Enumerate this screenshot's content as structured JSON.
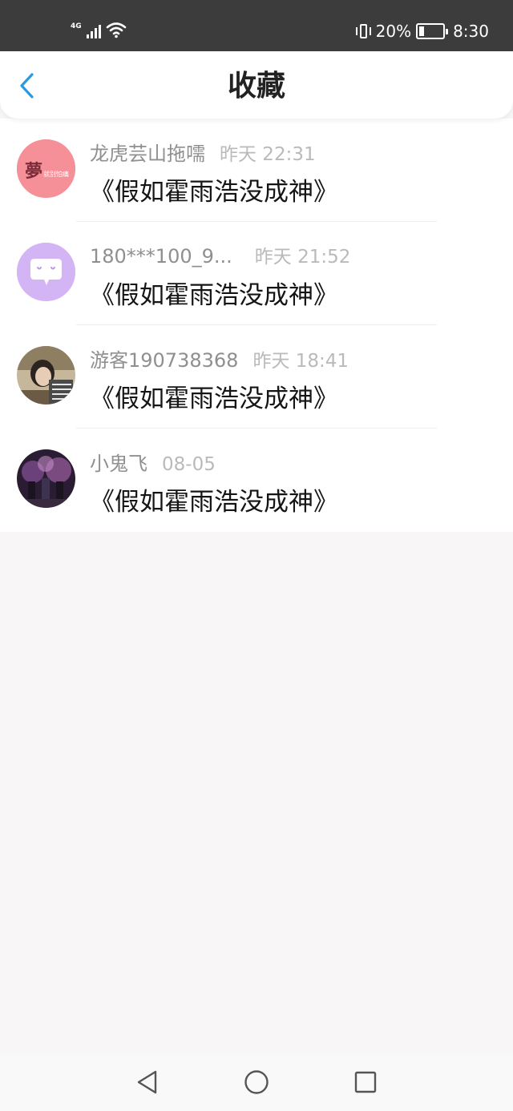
{
  "status_bar": {
    "network": "4G",
    "battery_percent": "20%",
    "battery_level": 0.2,
    "time": "8:30",
    "icons": [
      "signal-icon",
      "wifi-icon",
      "vibrate-icon",
      "battery-charging-icon"
    ]
  },
  "header": {
    "title": "收藏",
    "back_icon": "chevron-left-icon",
    "accent_color": "#2a9ae0"
  },
  "items": [
    {
      "name": "龙虎芸山拖嚅",
      "time": "昨天 22:31",
      "title": "《假如霍雨浩没成神》",
      "avatar_badge": "夢",
      "avatar_caption": "就别怕痛"
    },
    {
      "name": "180***100_9...",
      "time": "昨天 21:52",
      "title": "《假如霍雨浩没成神》"
    },
    {
      "name": "游客190738368",
      "time": "昨天 18:41",
      "title": "《假如霍雨浩没成神》"
    },
    {
      "name": "小鬼飞",
      "time": "08-05",
      "title": "《假如霍雨浩没成神》"
    }
  ],
  "nav_bar": {
    "icons": [
      "back-triangle-icon",
      "home-circle-icon",
      "recents-square-icon"
    ]
  }
}
